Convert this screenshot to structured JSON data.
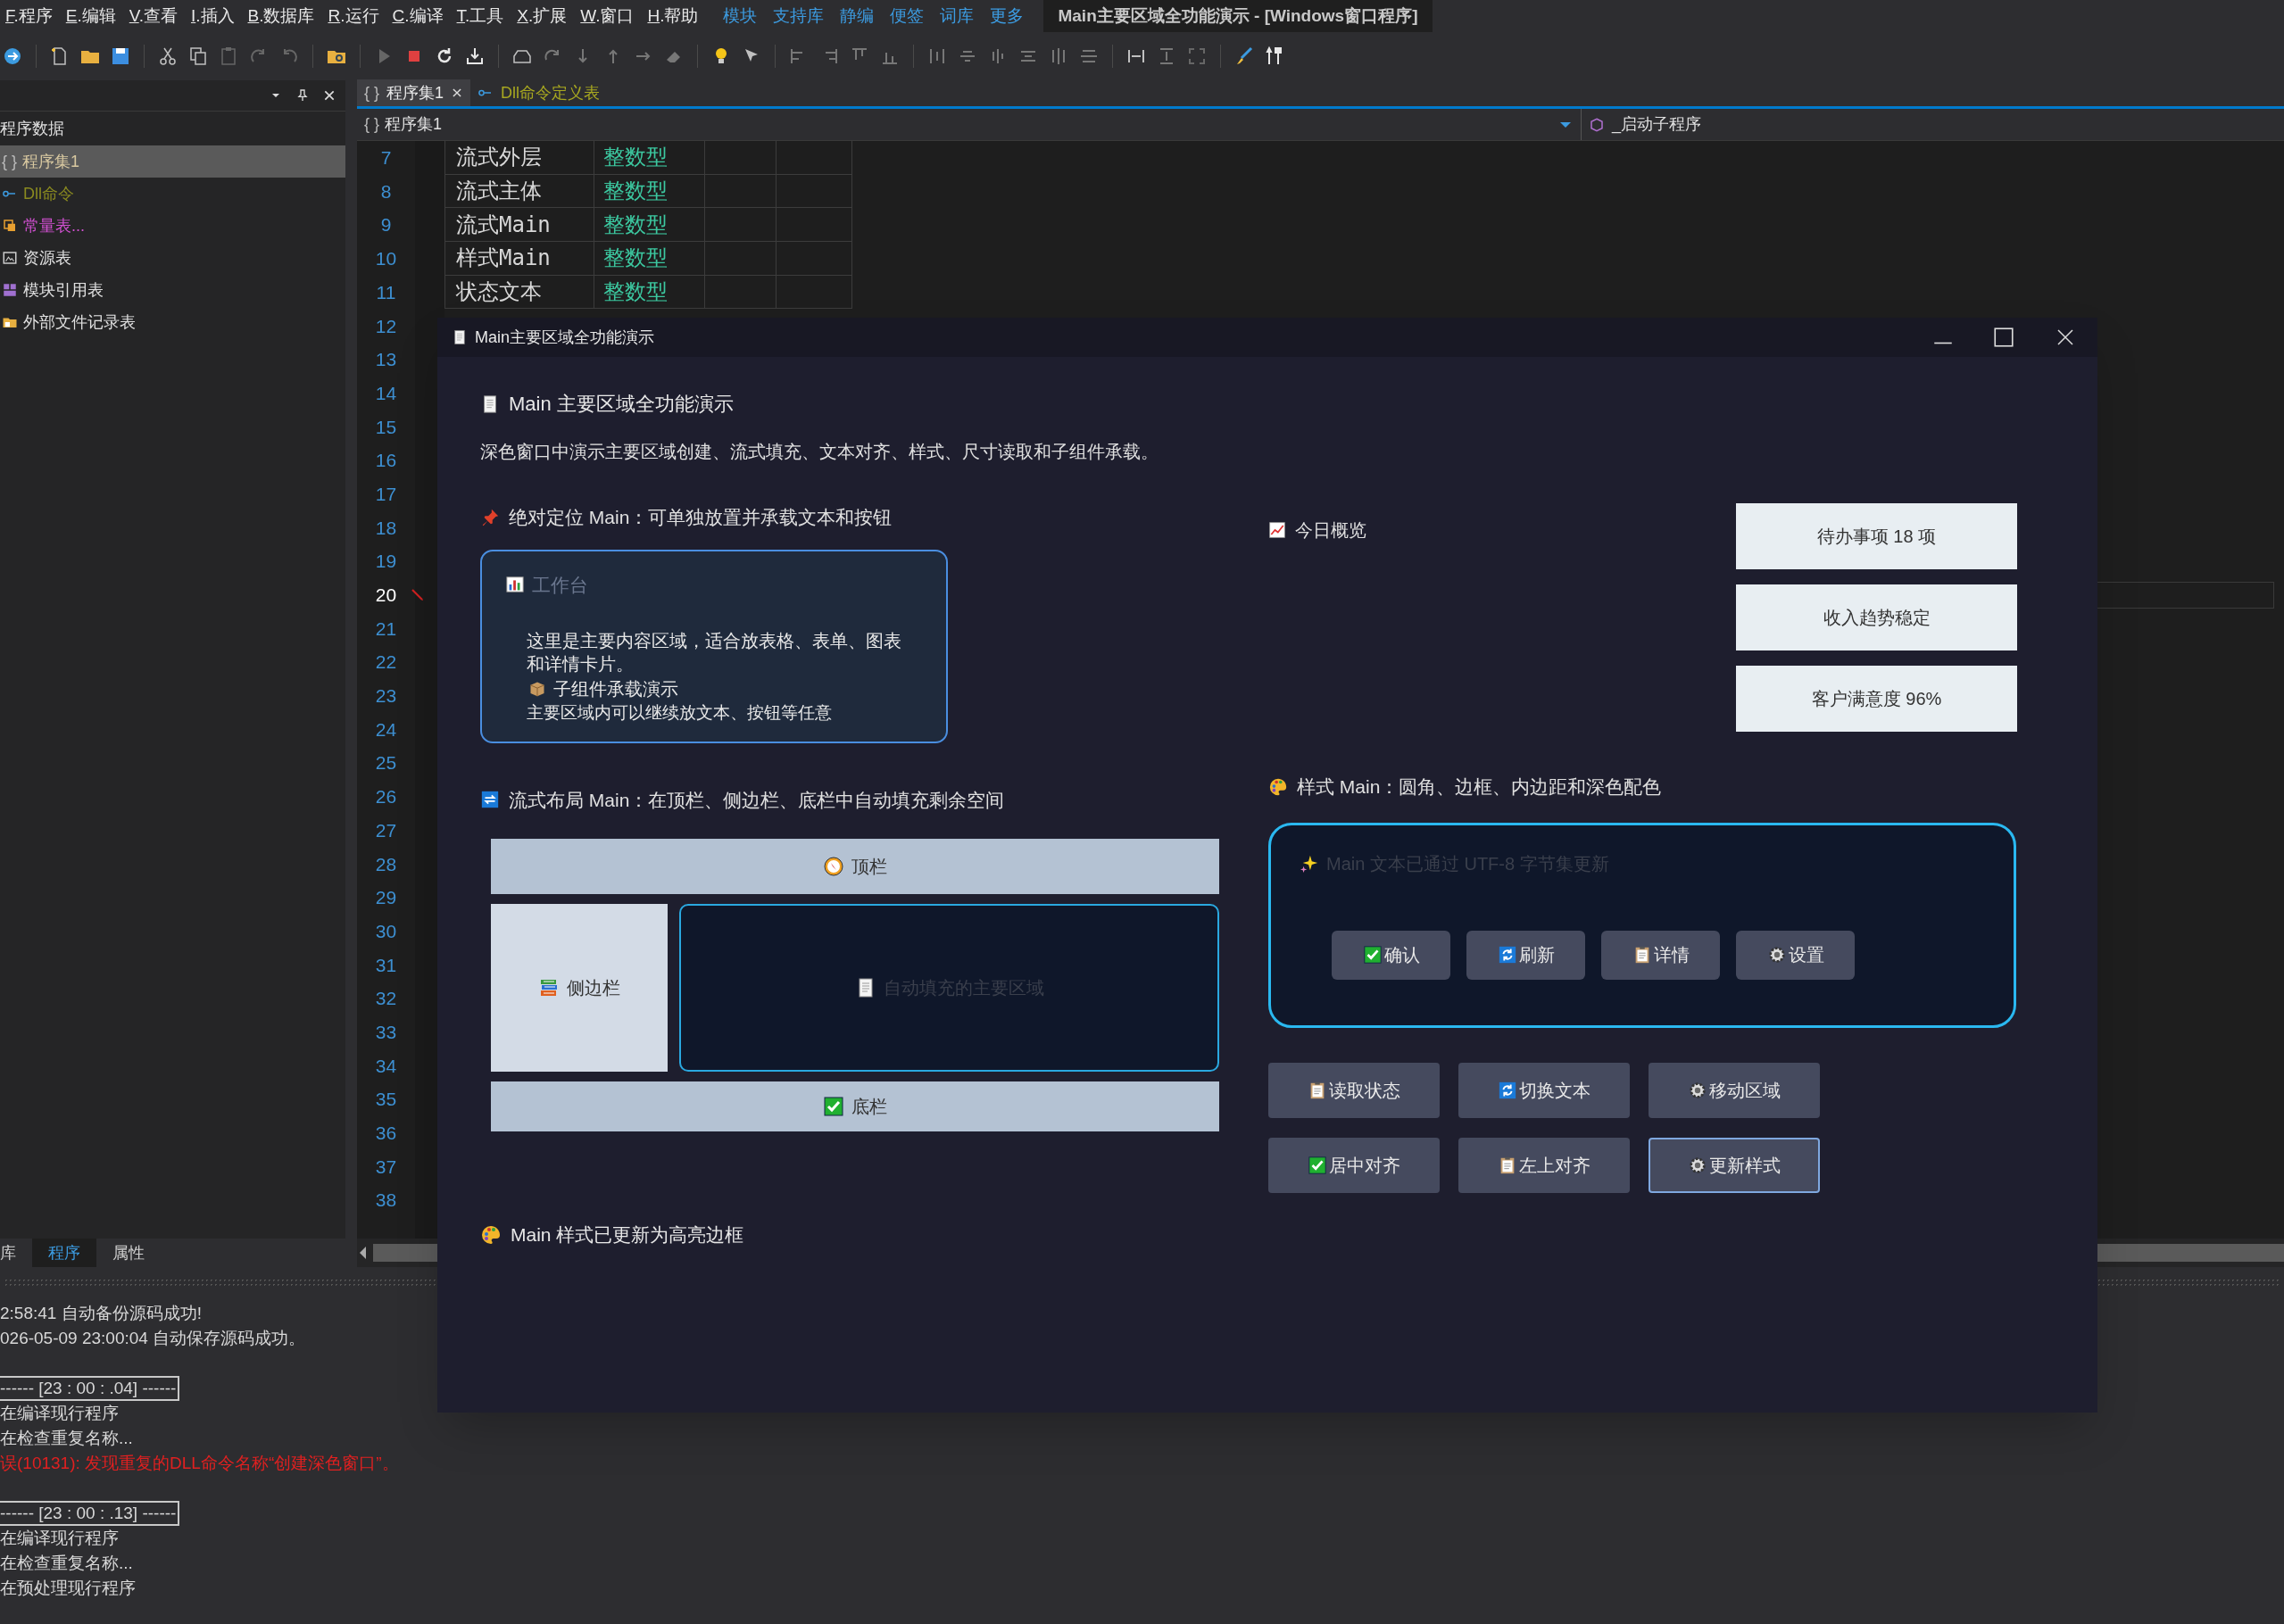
{
  "menu_bar": {
    "items": [
      "F.程序",
      "E.编辑",
      "V.查看",
      "I.插入",
      "B.数据库",
      "R.运行",
      "C.编译",
      "T.工具",
      "X.扩展",
      "W.窗口",
      "H.帮助"
    ],
    "quick_links": [
      "模块",
      "支持库",
      "静编",
      "便签",
      "词库",
      "更多"
    ],
    "title": "Main主要区域全功能演示 - [Windows窗口程序]"
  },
  "left_panel": {
    "header": "程序数据",
    "items": [
      {
        "label": "程序集1",
        "icon": "{ }",
        "selected": true,
        "color": "#d8c8a0"
      },
      {
        "label": "Dll命令",
        "selected": false,
        "color": "#8a8a20"
      },
      {
        "label": "常量表...",
        "selected": false,
        "color": "#d050d0"
      },
      {
        "label": "资源表",
        "selected": false,
        "color": "#e0e0e0"
      },
      {
        "label": "模块引用表",
        "selected": false,
        "color": "#e0e0e0"
      },
      {
        "label": "外部文件记录表",
        "selected": false,
        "color": "#e0e0e0"
      }
    ],
    "bottom_tabs": [
      {
        "label": "库",
        "selected": false
      },
      {
        "label": "程序",
        "selected": true
      },
      {
        "label": "属性",
        "selected": false
      }
    ]
  },
  "editor": {
    "tabs": [
      {
        "label": "程序集1",
        "icon": "{ }",
        "selected": true
      },
      {
        "label": "Dll命令定义表",
        "selected": false
      }
    ],
    "breadcrumb_icon": "{ }",
    "breadcrumb": "程序集1",
    "procedure": "_启动子程序",
    "rows": [
      {
        "name": "流式外层",
        "type": "整数型"
      },
      {
        "name": "流式主体",
        "type": "整数型"
      },
      {
        "name": "流式Main",
        "type": "整数型"
      },
      {
        "name": "样式Main",
        "type": "整数型"
      },
      {
        "name": "状态文本",
        "type": "整数型"
      }
    ],
    "lines": [
      {
        "number": "7",
        "current": false
      },
      {
        "number": "8",
        "current": false
      },
      {
        "number": "9",
        "current": false
      },
      {
        "number": "10",
        "current": false
      },
      {
        "number": "11",
        "current": false
      },
      {
        "number": "12",
        "current": false
      },
      {
        "number": "13",
        "current": false
      },
      {
        "number": "14",
        "current": false
      },
      {
        "number": "15",
        "current": false
      },
      {
        "number": "16",
        "current": false
      },
      {
        "number": "17",
        "current": false
      },
      {
        "number": "18",
        "current": false
      },
      {
        "number": "19",
        "current": false
      },
      {
        "number": "20",
        "current": true
      },
      {
        "number": "21",
        "current": false
      },
      {
        "number": "22",
        "current": false
      },
      {
        "number": "23",
        "current": false
      },
      {
        "number": "24",
        "current": false
      },
      {
        "number": "25",
        "current": false
      },
      {
        "number": "26",
        "current": false
      },
      {
        "number": "27",
        "current": false
      },
      {
        "number": "28",
        "current": false
      },
      {
        "number": "29",
        "current": false
      },
      {
        "number": "30",
        "current": false
      },
      {
        "number": "31",
        "current": false
      },
      {
        "number": "32",
        "current": false
      },
      {
        "number": "33",
        "current": false
      },
      {
        "number": "34",
        "current": false
      },
      {
        "number": "35",
        "current": false
      },
      {
        "number": "36",
        "current": false
      },
      {
        "number": "37",
        "current": false
      },
      {
        "number": "38",
        "current": false
      }
    ]
  },
  "output": {
    "lines": [
      {
        "text": "2:58:41 自动备份源码成功!",
        "kind": "normal"
      },
      {
        "text": "026-05-09 23:00:04 自动保存源码成功。",
        "kind": "normal"
      },
      {
        "text": "------ [23 : 00 : .04] ------",
        "kind": "separator"
      },
      {
        "text": "在编译现行程序",
        "kind": "normal"
      },
      {
        "text": "在检查重复名称...",
        "kind": "normal"
      },
      {
        "text": "误(10131): 发现重复的DLL命令名称“创建深色窗口”。",
        "kind": "error"
      },
      {
        "text": "------ [23 : 00 : .13] ------",
        "kind": "separator"
      },
      {
        "text": "在编译现行程序",
        "kind": "normal"
      },
      {
        "text": "在检查重复名称...",
        "kind": "normal"
      },
      {
        "text": "在预处理现行程序",
        "kind": "normal"
      }
    ]
  },
  "dialog": {
    "title": "Main主要区域全功能演示",
    "heading": "Main 主要区域全功能演示",
    "description": "深色窗口中演示主要区域创建、流式填充、文本对齐、样式、尺寸读取和子组件承载。",
    "absolute_section": {
      "title": "绝对定位 Main：可单独放置并承载文本和按钮",
      "card_title": "工作台",
      "card_body": "这里是主要内容区域，适合放表格、表单、图表和详情卡片。",
      "child_title": "子组件承载演示",
      "child_text": "主要区域内可以继续放文本、按钮等任意"
    },
    "flow_section": {
      "title": "流式布局 Main：在顶栏、侧边栏、底栏中自动填充剩余空间",
      "top_bar": "顶栏",
      "side_bar": "侧边栏",
      "main_area": "自动填充的主要区域",
      "bottom_bar": "底栏"
    },
    "status": "Main 样式已更新为高亮边框",
    "overview": {
      "title": "今日概览",
      "stats": [
        "待办事项 18 项",
        "收入趋势稳定",
        "客户满意度 96%"
      ]
    },
    "style_section": {
      "title": "样式 Main：圆角、边框、内边距和深色配色",
      "card_text": "Main 文本已通过 UTF-8 字节集更新",
      "buttons": [
        "确认",
        "刷新",
        "详情",
        "设置"
      ]
    },
    "actions": [
      {
        "label": "读取状态",
        "selected": false
      },
      {
        "label": "切换文本",
        "selected": false
      },
      {
        "label": "移动区域",
        "selected": false
      },
      {
        "label": "居中对齐",
        "selected": false
      },
      {
        "label": "左上对齐",
        "selected": false
      },
      {
        "label": "更新样式",
        "selected": true
      }
    ]
  }
}
